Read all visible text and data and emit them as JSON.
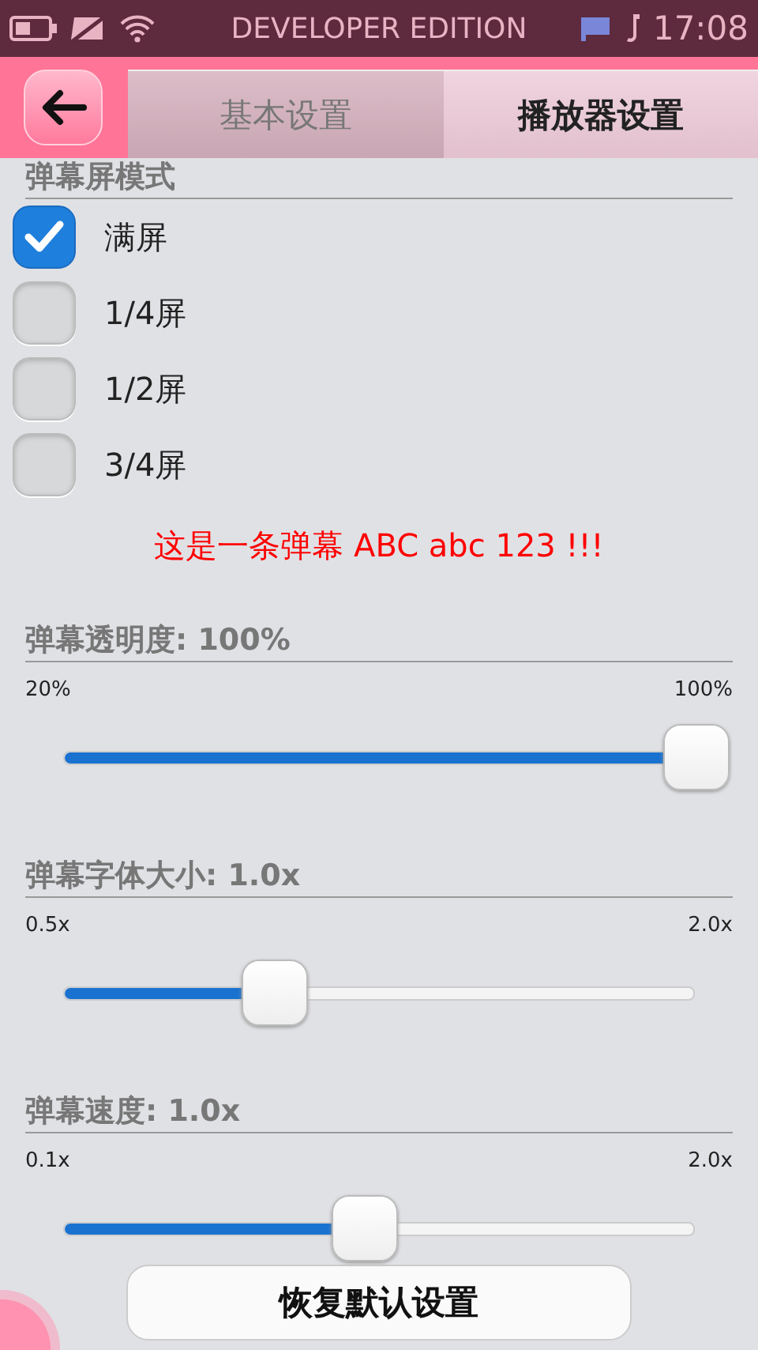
{
  "status_bar": {
    "title": "DEVELOPER EDITION",
    "time": "17:08"
  },
  "toolbar": {
    "tabs": [
      {
        "label": "基本设置",
        "selected": false
      },
      {
        "label": "播放器设置",
        "selected": true
      }
    ]
  },
  "mode_section": {
    "title": "弹幕屏模式",
    "options": [
      {
        "label": "满屏",
        "checked": true
      },
      {
        "label": "1/4屏",
        "checked": false
      },
      {
        "label": "1/2屏",
        "checked": false
      },
      {
        "label": "3/4屏",
        "checked": false
      }
    ]
  },
  "preview_text": "这是一条弹幕 ABC abc 123 !!!",
  "sliders": [
    {
      "title": "弹幕透明度: 100%",
      "min_label": "20%",
      "max_label": "100%",
      "level": 1.0
    },
    {
      "title": "弹幕字体大小: 1.0x",
      "min_label": "0.5x",
      "max_label": "2.0x",
      "level": 0.333
    },
    {
      "title": "弹幕速度: 1.0x",
      "min_label": "0.1x",
      "max_label": "2.0x",
      "level": 0.474
    }
  ],
  "reset_button": "恢复默认设置"
}
